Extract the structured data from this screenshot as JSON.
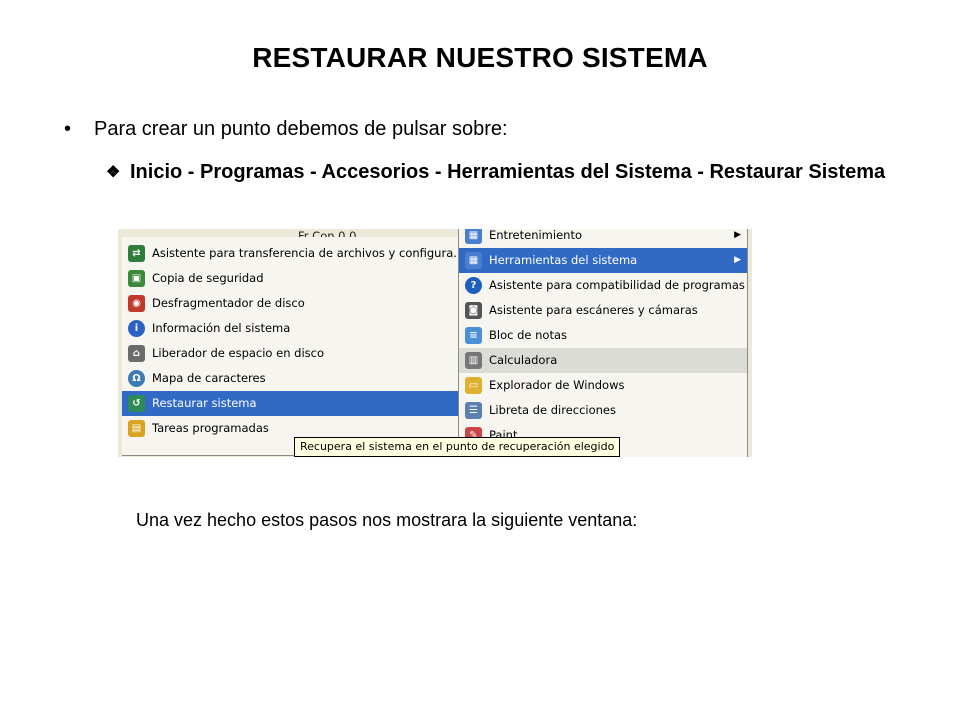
{
  "slide": {
    "title": "RESTAURAR NUESTRO SISTEMA",
    "bullet": "Para crear un punto debemos de pulsar sobre:",
    "sub_item": "Inicio - Programas - Accesorios - Herramientas del Sistema - Restaurar Sistema",
    "caption": "Una vez hecho estos pasos nos mostrara la siguiente ventana:"
  },
  "screenshot": {
    "partial_top": "Fr Con 0.0",
    "left_menu": [
      {
        "label": "Asistente para transferencia de archivos y configura...",
        "icon": "transfer-wizard-icon",
        "color": "#2f7d3a"
      },
      {
        "label": "Copia de seguridad",
        "icon": "backup-icon",
        "color": "#3a8a3a"
      },
      {
        "label": "Desfragmentador de disco",
        "icon": "defrag-icon",
        "color": "#c0392b"
      },
      {
        "label": "Información del sistema",
        "icon": "system-info-icon",
        "color": "#2a63c4"
      },
      {
        "label": "Liberador de espacio en disco",
        "icon": "disk-cleanup-icon",
        "color": "#6b6b6b"
      },
      {
        "label": "Mapa de caracteres",
        "icon": "character-map-icon",
        "color": "#3b7bb8"
      },
      {
        "label": "Restaurar sistema",
        "icon": "system-restore-icon",
        "color": "#2e8b57"
      },
      {
        "label": "Tareas programadas",
        "icon": "scheduled-tasks-icon",
        "color": "#d9a520"
      }
    ],
    "right_menu": [
      {
        "label": "Entretenimiento",
        "icon": "entertainment-icon",
        "color": "#4a7fd0",
        "submenu": true
      },
      {
        "label": "Herramientas del sistema",
        "icon": "system-tools-icon",
        "color": "#4a7fd0",
        "submenu": true
      },
      {
        "label": "Asistente para compatibilidad de programas",
        "icon": "compatibility-wizard-icon",
        "color": "#1d5fbf"
      },
      {
        "label": "Asistente para escáneres y cámaras",
        "icon": "scanner-camera-icon",
        "color": "#555555"
      },
      {
        "label": "Bloc de notas",
        "icon": "notepad-icon",
        "color": "#4a90d9"
      },
      {
        "label": "Calculadora",
        "icon": "calculator-icon",
        "color": "#777777"
      },
      {
        "label": "Explorador de Windows",
        "icon": "windows-explorer-icon",
        "color": "#e0b030"
      },
      {
        "label": "Libreta de direcciones",
        "icon": "address-book-icon",
        "color": "#5a7fb0"
      },
      {
        "label": "Paint",
        "icon": "paint-icon",
        "color": "#cc4444"
      }
    ],
    "tooltip": "Recupera el sistema en el punto de recuperación elegido",
    "colors": {
      "selection": "#316ac5",
      "menu_bg": "#f6f5ef",
      "tooltip_bg": "#ffffe1"
    }
  }
}
